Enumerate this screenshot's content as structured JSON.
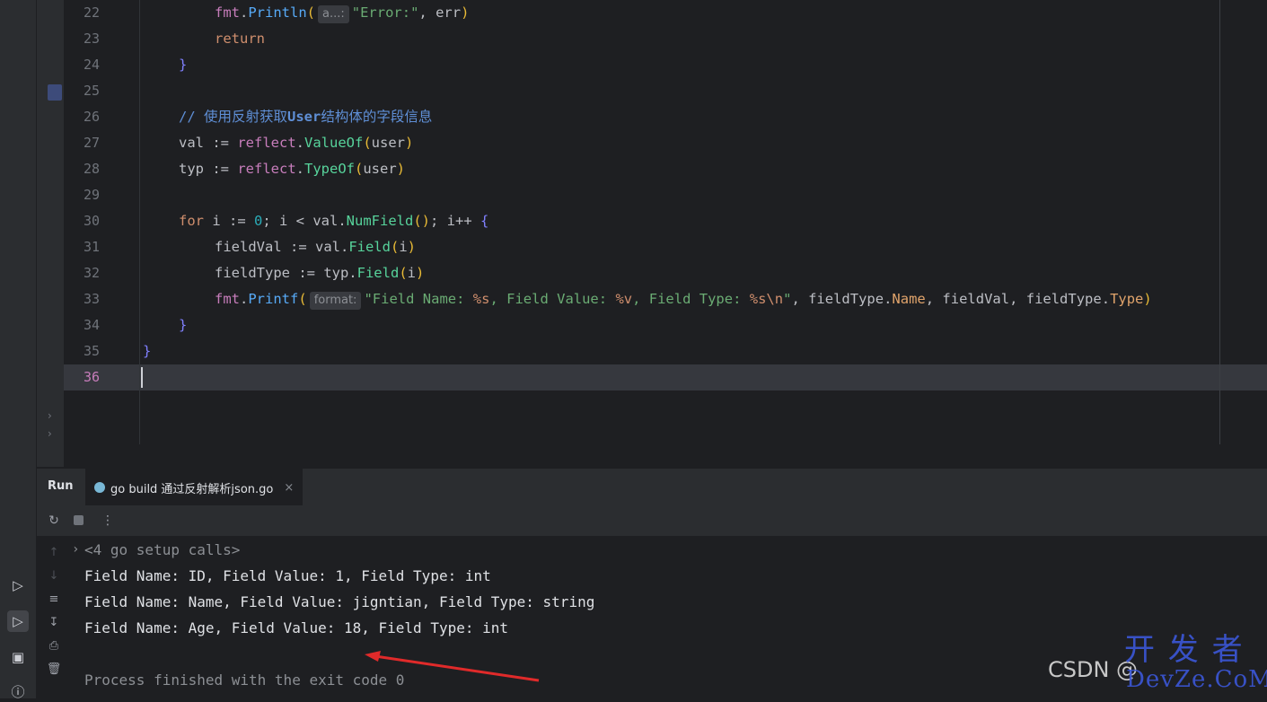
{
  "editor": {
    "lines": [
      {
        "n": "22",
        "indent": 2,
        "html": "<span class=\"pkg\">fmt</span>.<span class=\"call\">Println</span><span class=\"p1\">(</span><span class=\"hint\">a...:</span><span class=\"str\">\"Error:\"</span>, err<span class=\"p1\">)</span>"
      },
      {
        "n": "23",
        "indent": 2,
        "html": "<span class=\"kw\">return</span>"
      },
      {
        "n": "24",
        "indent": 1,
        "html": "<span class=\"p3\">}</span>"
      },
      {
        "n": "25",
        "indent": 0,
        "html": ""
      },
      {
        "n": "26",
        "indent": 1,
        "html": "<span class=\"cmt-blue\">// 使用反射获取<b>User</b>结构体的字段信息</span>"
      },
      {
        "n": "27",
        "indent": 1,
        "html": "val := <span class=\"pkg\">reflect</span>.<span class=\"green\">ValueOf</span><span class=\"p1\">(</span>user<span class=\"p1\">)</span>"
      },
      {
        "n": "28",
        "indent": 1,
        "html": "typ := <span class=\"pkg\">reflect</span>.<span class=\"green\">TypeOf</span><span class=\"p1\">(</span>user<span class=\"p1\">)</span>"
      },
      {
        "n": "29",
        "indent": 0,
        "html": ""
      },
      {
        "n": "30",
        "indent": 1,
        "html": "<span class=\"kw\">for</span> i := <span class=\"num\">0</span>; i &lt; val.<span class=\"green\">NumField</span><span class=\"p1\">()</span>; i++ <span class=\"p3\">{</span>"
      },
      {
        "n": "31",
        "indent": 2,
        "html": "fieldVal := val.<span class=\"green\">Field</span><span class=\"p1\">(</span>i<span class=\"p1\">)</span>"
      },
      {
        "n": "32",
        "indent": 2,
        "html": "fieldType := typ.<span class=\"green\">Field</span><span class=\"p1\">(</span>i<span class=\"p1\">)</span>"
      },
      {
        "n": "33",
        "indent": 2,
        "html": "<span class=\"pkg\">fmt</span>.<span class=\"call\">Printf</span><span class=\"p1\">(</span><span class=\"hint\">format:</span><span class=\"str\">\"Field Name: <span class=\"esc\">%s</span>, Field Value: <span class=\"esc\">%v</span>, Field Type: <span class=\"esc\">%s\\n</span>\"</span>, fieldType.<span class=\"orange\">Name</span>, fieldVal, fieldType.<span class=\"orange\">Type</span><span class=\"p1\">)</span>"
      },
      {
        "n": "34",
        "indent": 1,
        "html": "<span class=\"p3\">}</span>"
      },
      {
        "n": "35",
        "indent": 0,
        "html": "<span class=\"p3\">}</span>"
      },
      {
        "n": "36",
        "indent": 0,
        "html": "",
        "current": true
      }
    ]
  },
  "run": {
    "label": "Run",
    "tab_label": "go build 通过反射解析json.go",
    "tab_close": "×"
  },
  "console": {
    "setup_calls": "<4 go setup calls>",
    "output": [
      "Field Name: ID, Field Value: 1, Field Type: int",
      "Field Name: Name, Field Value: jigntian, Field Type: string",
      "Field Name: Age, Field Value: 18, Field Type: int"
    ],
    "exit_message": "Process finished with the exit code 0"
  },
  "watermark": {
    "csdn": "CSDN @",
    "brand_top": "开 发 者",
    "brand_bottom": "DevZe.CoM"
  },
  "colors": {
    "editor_bg": "#1e1f22",
    "panel_bg": "#2b2d30",
    "accent_tab": "#3574f0",
    "arrow": "#e02a2a"
  }
}
